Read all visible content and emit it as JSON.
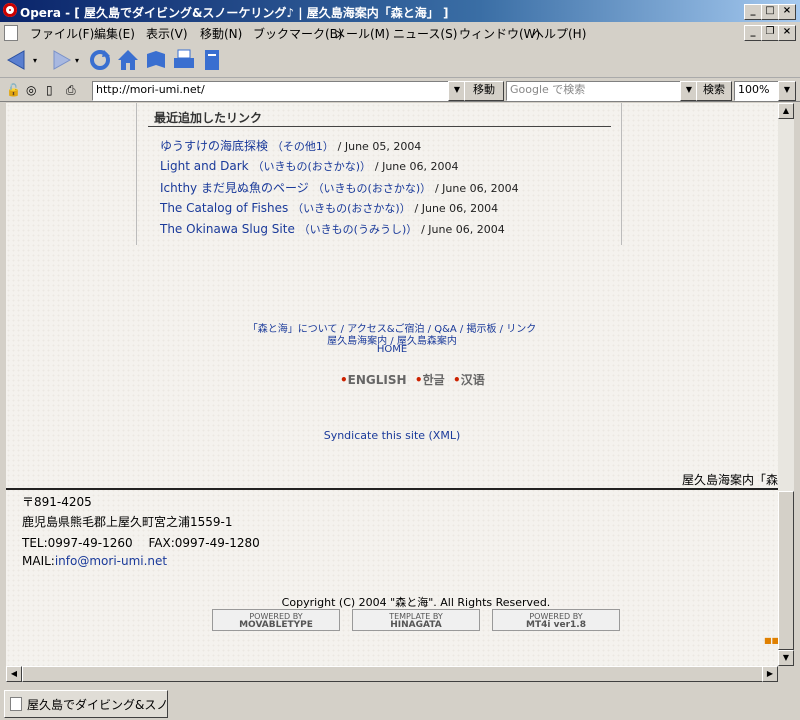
{
  "window": {
    "title": "Opera - [ 屋久島でダイビング&スノーケリング♪ | 屋久島海案内「森と海」 ]"
  },
  "menu": {
    "items": [
      "ファイル(F)",
      "編集(E)",
      "表示(V)",
      "移動(N)",
      "ブックマーク(B)",
      "メール(M)",
      "ニュース(S)",
      "ウィンドウ(W)",
      "ヘルプ(H)"
    ]
  },
  "address": {
    "url": "http://mori-umi.net/",
    "go_label": "移動",
    "search_placeholder": "Google で検索",
    "search_label": "検索",
    "zoom": "100%"
  },
  "recent": {
    "heading": "最近追加したリンク",
    "links": [
      {
        "title": "ゆうすけの海底探検",
        "category": "（その他1）",
        "date": " / June 05, 2004"
      },
      {
        "title": "Light and Dark",
        "category": "（いきもの(おさかな)）",
        "date": " / June 06, 2004"
      },
      {
        "title": "Ichthy まだ見ぬ魚のページ",
        "category": "（いきもの(おさかな)）",
        "date": " / June 06, 2004"
      },
      {
        "title": "The Catalog of Fishes",
        "category": "（いきもの(おさかな)）",
        "date": " / June 06, 2004"
      },
      {
        "title": "The Okinawa Slug Site",
        "category": "（いきもの(うみうし)）",
        "date": " / June 06, 2004"
      }
    ]
  },
  "footer_nav": {
    "line1": "「森と海」について / アクセス&ご宿泊 / Q&A / 掲示板 / リンク",
    "line2": "屋久島海案内 / 屋久島森案内",
    "line3": "HOME"
  },
  "languages": [
    "ENGLISH",
    "한글",
    "汉语"
  ],
  "syndicate": "Syndicate this site (XML)",
  "site_name_tail": "屋久島海案内「森",
  "contact": {
    "postal": "〒891-4205",
    "address": "鹿児島県熊毛郡上屋久町宮之浦1559-1",
    "tel_fax": "TEL:0997-49-1260　 FAX:0997-49-1280",
    "mail_label": "MAIL:",
    "mail": "info@mori-umi.net"
  },
  "copyright": "Copyright (C) 2004 \"森と海\". All Rights Reserved.",
  "badges": [
    {
      "top": "POWERED BY",
      "bottom": "MOVABLETYPE"
    },
    {
      "top": "TEMPLATE BY",
      "bottom": "HINAGATA"
    },
    {
      "top": "POWERED BY",
      "bottom": "MT4i ver1.8"
    }
  ],
  "statusbar": {
    "tab_title": "屋久島でダイビング&スノ..."
  },
  "colors": {
    "link": "#1a3a9a",
    "bullet": "#cc2200",
    "titlebar": "#0a246a"
  }
}
